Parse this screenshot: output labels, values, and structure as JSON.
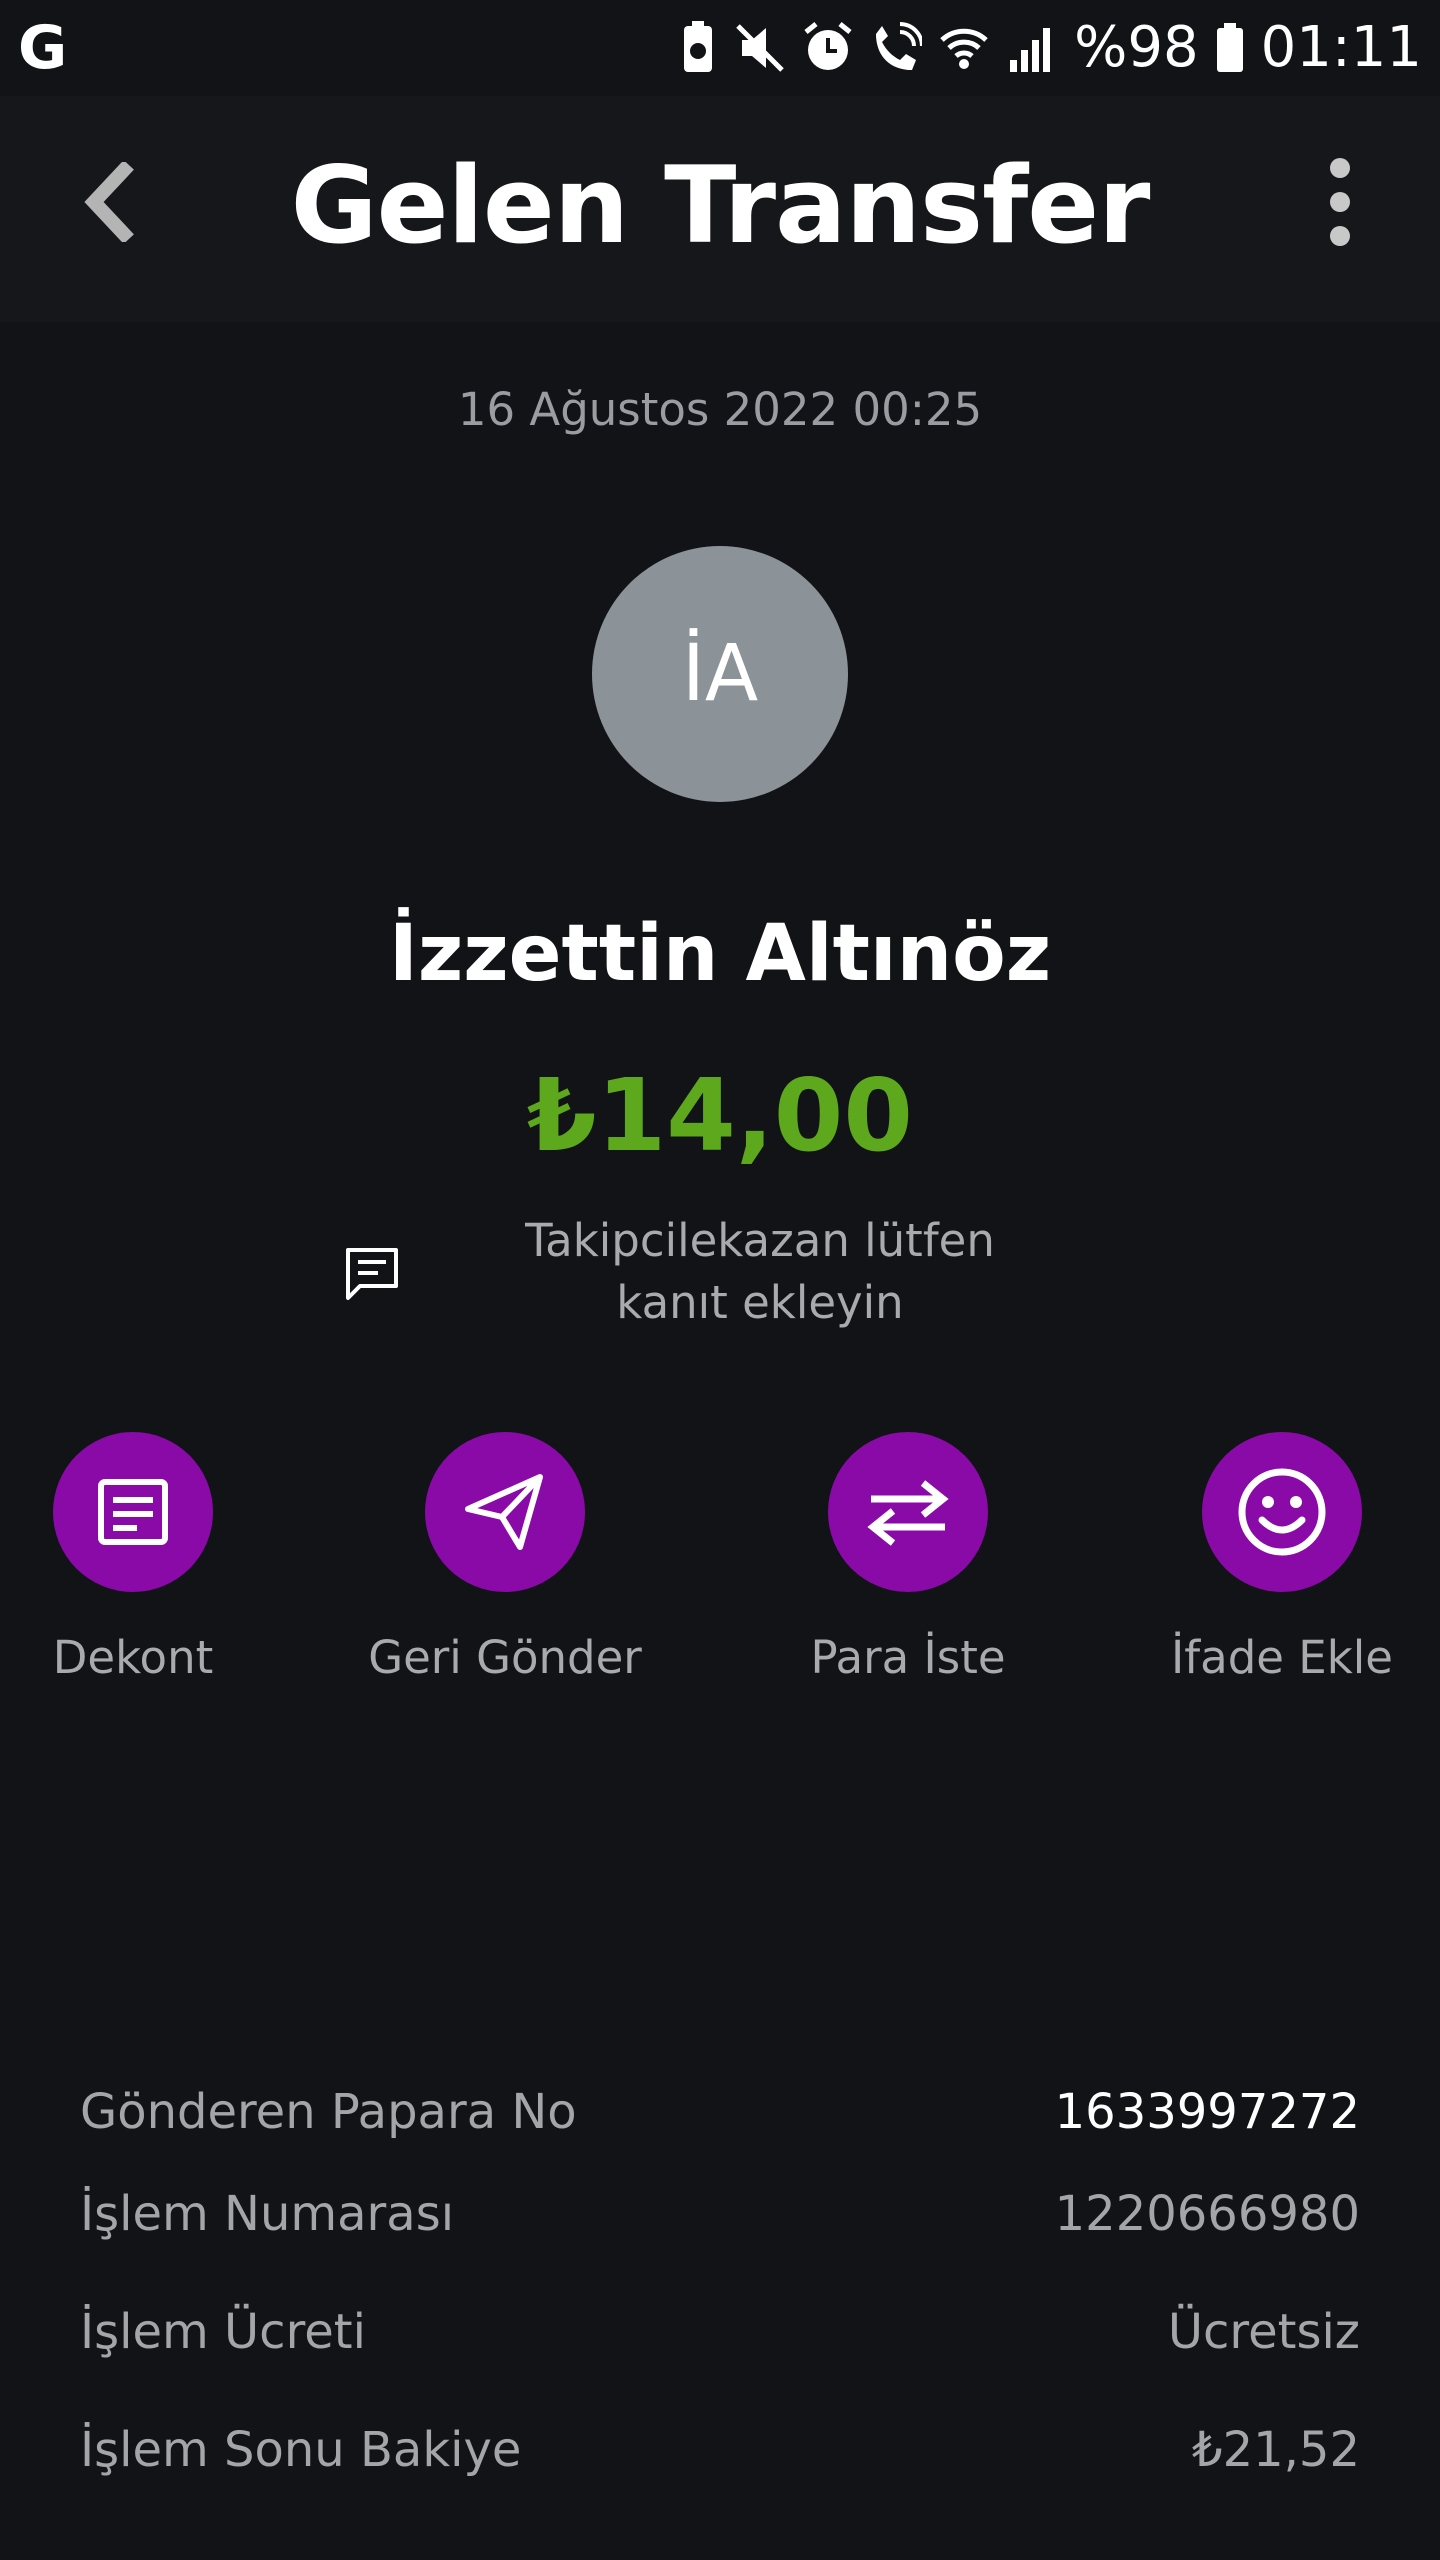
{
  "status_bar": {
    "left_glyph": "G",
    "battery_text": "%98",
    "time": "01:11",
    "icons": [
      "battery-saver-icon",
      "mute-icon",
      "alarm-icon",
      "wifi-call-icon",
      "wifi-icon",
      "signal-icon",
      "battery-icon"
    ]
  },
  "header": {
    "title": "Gelen Transfer",
    "back_icon": "chevron-left-icon",
    "more_icon": "more-vertical-icon"
  },
  "transfer": {
    "date": "16 Ağustos 2022 00:25",
    "avatar_initials": "İA",
    "sender_name": "İzzettin Altınöz",
    "amount": "₺14,00",
    "description": "Takipcilekazan lütfen kanıt ekleyin",
    "amount_color": "#5ea81d"
  },
  "actions": [
    {
      "label": "Dekont",
      "icon": "receipt-icon"
    },
    {
      "label": "Geri Gönder",
      "icon": "send-icon"
    },
    {
      "label": "Para İste",
      "icon": "swap-icon"
    },
    {
      "label": "İfade Ekle",
      "icon": "smiley-icon"
    }
  ],
  "details": [
    {
      "label": "Gönderen Papara No",
      "value": "1633997272"
    },
    {
      "label": "İşlem Numarası",
      "value": "1220666980"
    },
    {
      "label": "İşlem Ücreti",
      "value": "Ücretsiz"
    },
    {
      "label": "İşlem Sonu Bakiye",
      "value": "₺21,52"
    }
  ],
  "colors": {
    "background": "#121317",
    "accent_purple": "#8a0aa8",
    "avatar_gray": "#8b9298"
  }
}
